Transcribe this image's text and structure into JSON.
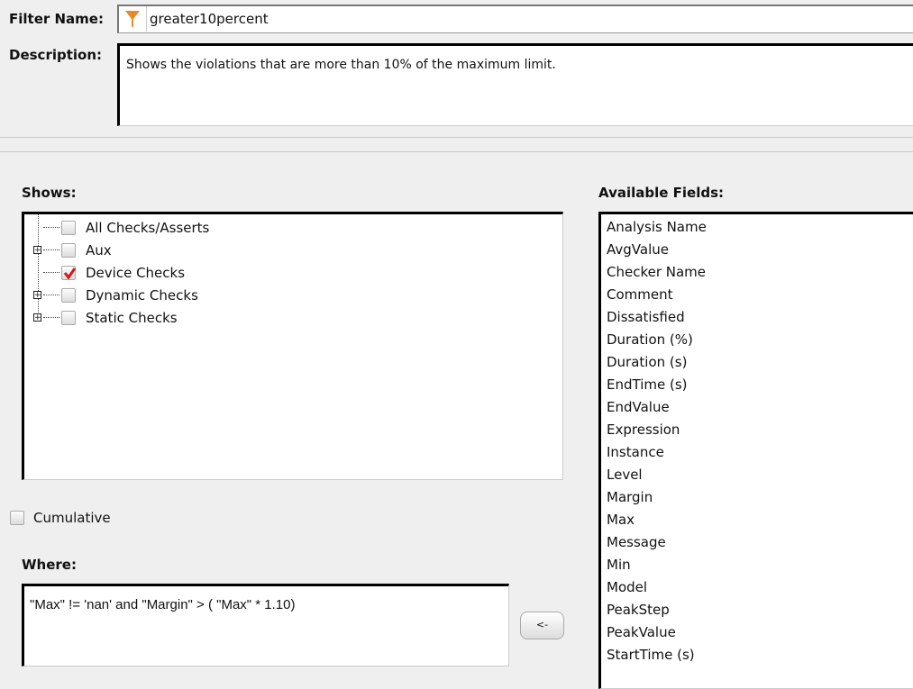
{
  "filter_name": {
    "label": "Filter Name:",
    "value": "greater10percent",
    "icon": "funnel-icon"
  },
  "description": {
    "label": "Description:",
    "value": "Shows the violations that are more than 10% of the maximum limit."
  },
  "shows": {
    "label": "Shows:",
    "items": [
      {
        "label": "All Checks/Asserts",
        "checked": false,
        "expandable": false
      },
      {
        "label": "Aux",
        "checked": false,
        "expandable": true
      },
      {
        "label": "Device Checks",
        "checked": true,
        "expandable": false
      },
      {
        "label": "Dynamic Checks",
        "checked": false,
        "expandable": true
      },
      {
        "label": "Static Checks",
        "checked": false,
        "expandable": true
      }
    ]
  },
  "available_fields": {
    "label": "Available Fields:",
    "items": [
      "Analysis Name",
      "AvgValue",
      "Checker Name",
      "Comment",
      "Dissatisfied",
      "Duration (%)",
      "Duration (s)",
      "EndTime (s)",
      "EndValue",
      "Expression",
      "Instance",
      "Level",
      "Margin",
      "Max",
      "Message",
      "Min",
      "Model",
      "PeakStep",
      "PeakValue",
      "StartTime (s)"
    ]
  },
  "cumulative": {
    "label": "Cumulative",
    "checked": false
  },
  "where": {
    "label": "Where:",
    "value": "\"Max\" != 'nan' and \"Margin\" > ( \"Max\" * 1.10)"
  },
  "insert_button": {
    "label": "<-"
  },
  "colors": {
    "check": "#d01818",
    "funnel": "#e8892a"
  }
}
